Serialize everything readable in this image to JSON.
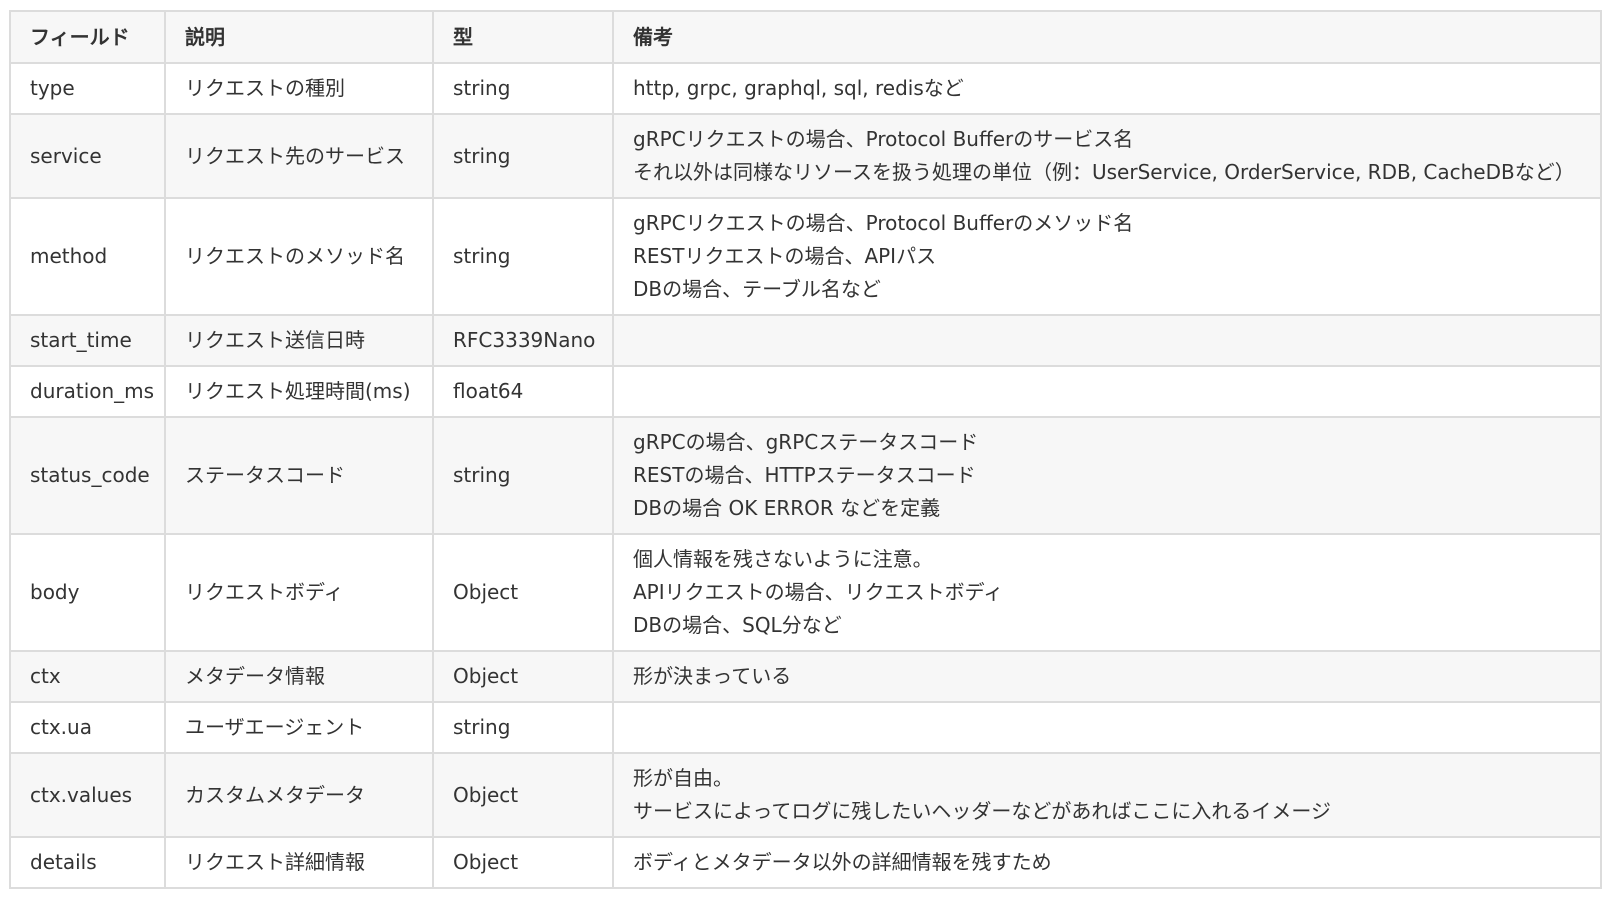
{
  "table": {
    "headers": [
      "フィールド",
      "説明",
      "型",
      "備考"
    ],
    "rows": [
      {
        "field": "type",
        "desc": "リクエストの種別",
        "type": "string",
        "notes": [
          "http, grpc, graphql, sql, redisなど"
        ]
      },
      {
        "field": "service",
        "desc": "リクエスト先のサービス",
        "type": "string",
        "notes": [
          "gRPCリクエストの場合、Protocol Bufferのサービス名",
          "それ以外は同様なリソースを扱う処理の単位（例：UserService, OrderService, RDB, CacheDBなど）"
        ]
      },
      {
        "field": "method",
        "desc": "リクエストのメソッド名",
        "type": "string",
        "notes": [
          "gRPCリクエストの場合、Protocol Bufferのメソッド名",
          "RESTリクエストの場合、APIパス",
          "DBの場合、テーブル名など"
        ]
      },
      {
        "field": "start_time",
        "desc": "リクエスト送信日時",
        "type": "RFC3339Nano",
        "notes": []
      },
      {
        "field": "duration_ms",
        "desc": "リクエスト処理時間(ms)",
        "type": "float64",
        "notes": []
      },
      {
        "field": "status_code",
        "desc": "ステータスコード",
        "type": "string",
        "notes": [
          "gRPCの場合、gRPCステータスコード",
          "RESTの場合、HTTPステータスコード",
          "DBの場合 OK ERROR などを定義"
        ]
      },
      {
        "field": "body",
        "desc": "リクエストボディ",
        "type": "Object",
        "notes": [
          "個人情報を残さないように注意。",
          "APIリクエストの場合、リクエストボディ",
          "DBの場合、SQL分など"
        ]
      },
      {
        "field": "ctx",
        "desc": "メタデータ情報",
        "type": "Object",
        "notes": [
          "形が決まっている"
        ]
      },
      {
        "field": "ctx.ua",
        "desc": "ユーザエージェント",
        "type": "string",
        "notes": []
      },
      {
        "field": "ctx.values",
        "desc": "カスタムメタデータ",
        "type": "Object",
        "notes": [
          "形が自由。",
          "サービスによってログに残したいヘッダーなどがあればここに入れるイメージ"
        ]
      },
      {
        "field": "details",
        "desc": "リクエスト詳細情報",
        "type": "Object",
        "notes": [
          "ボディとメタデータ以外の詳細情報を残すため"
        ]
      }
    ]
  }
}
